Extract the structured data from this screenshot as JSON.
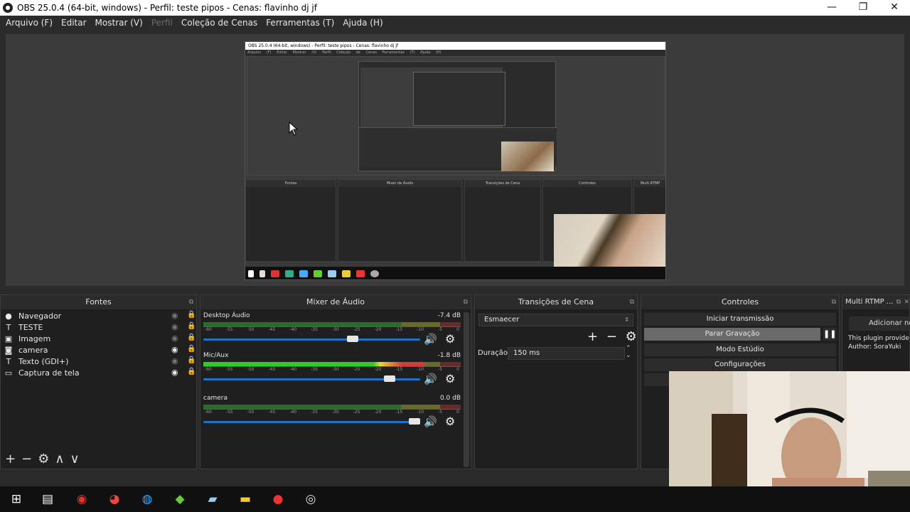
{
  "window": {
    "title": "OBS 25.0.4 (64-bit, windows) - Perfil: teste pipos - Cenas: flavinho dj jf",
    "controls": [
      "—",
      "❐",
      "✕"
    ]
  },
  "menu": [
    "Arquivo (F)",
    "Editar",
    "Mostrar (V)",
    "Perfil",
    "Coleção de Cenas",
    "Ferramentas (T)",
    "Ajuda (H)"
  ],
  "preview": {
    "title": "OBS 25.0.4 (64-bit, windows) - Perfil: teste pipos - Cenas: flavinho dj jf",
    "menu": "Arquivo (F) Editar Mostrar (V) Perfil Coleção de Cenas Ferramentas (T) Ajuda (H)",
    "dock_titles": [
      "Fontes",
      "Mixer de Áudio",
      "Transições de Cena",
      "Controles",
      "Multi RTMP"
    ]
  },
  "sources": {
    "title": "Fontes",
    "items": [
      {
        "name": "Navegador",
        "icon": "globe-icon",
        "glyph": "●",
        "visible": false
      },
      {
        "name": "TESTE",
        "icon": "text-icon",
        "glyph": "T",
        "visible": false
      },
      {
        "name": "Imagem",
        "icon": "image-icon",
        "glyph": "▣",
        "visible": false
      },
      {
        "name": "camera",
        "icon": "camera-icon",
        "glyph": "◙",
        "visible": true
      },
      {
        "name": "Texto (GDI+)",
        "icon": "text-icon",
        "glyph": "T",
        "visible": false
      },
      {
        "name": "Captura de tela",
        "icon": "monitor-icon",
        "glyph": "▭",
        "visible": true
      }
    ],
    "footer": [
      "+",
      "−",
      "⚙",
      "∧",
      "∨"
    ]
  },
  "mixer": {
    "title": "Mixer de Áudio",
    "ticks": [
      "-60",
      "-55",
      "-50",
      "-45",
      "-40",
      "-35",
      "-30",
      "-25",
      "-20",
      "-15",
      "-10",
      "-5",
      "0"
    ],
    "channels": [
      {
        "name": "Desktop Áudio",
        "db": "-7.4 dB",
        "level": 0,
        "volume": 0.7
      },
      {
        "name": "Mic/Aux",
        "db": "-1.8 dB",
        "level": 0.86,
        "volume": 0.88
      },
      {
        "name": "camera",
        "db": "0.0 dB",
        "level": 0,
        "volume": 1.0
      }
    ]
  },
  "transitions": {
    "title": "Transições de Cena",
    "selected": "Esmaecer",
    "duration_label": "Duração",
    "duration_value": "150 ms"
  },
  "controls": {
    "title": "Controles",
    "buttons": [
      "Iniciar transmissão",
      "Parar Gravação",
      "Modo Estúdio",
      "Configurações"
    ]
  },
  "rtmp": {
    "title": "Multi RTMP ...",
    "add_button": "Adicionar no",
    "info_line1": "This plugin provide",
    "info_line2": "Author: SoraYuki"
  },
  "taskbar": {
    "icons": [
      "windows-start-icon",
      "task-view-icon",
      "app-icon",
      "chrome-icon",
      "browser-icon",
      "app-green-icon",
      "app-blue-icon",
      "folder-icon",
      "recorder-icon",
      "obs-icon"
    ]
  },
  "colors": {
    "accent": "#1e73c9",
    "meter_green": "#2ecc2e",
    "meter_yellow": "#e4d83a",
    "meter_red": "#d63a3a"
  }
}
